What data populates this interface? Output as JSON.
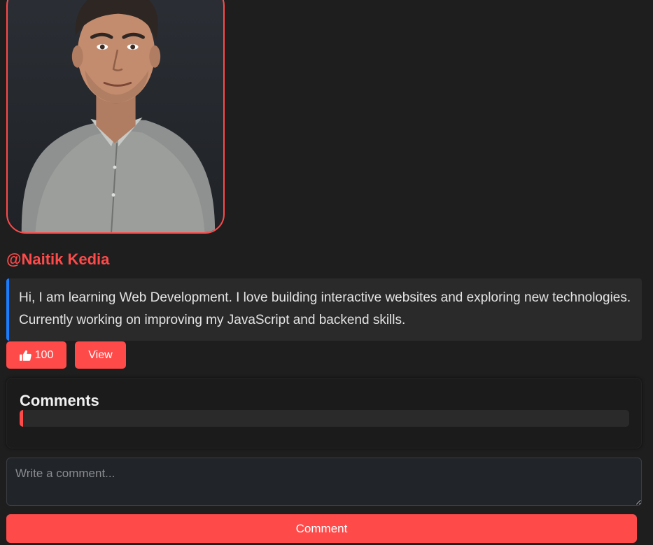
{
  "profile": {
    "username": "@Naitik Kedia",
    "bio": "Hi, I am learning Web Development. I love building interactive websites and exploring new technologies. Currently working on improving my JavaScript and backend skills.",
    "photo_icon": "profile-photo"
  },
  "actions": {
    "like_icon": "thumbs-up-icon",
    "like_count": "100",
    "view_label": "View"
  },
  "comments": {
    "title": "Comments",
    "items": []
  },
  "composer": {
    "placeholder": "Write a comment...",
    "value": "",
    "submit_label": "Comment"
  },
  "colors": {
    "accent": "#ff4a4a",
    "bio_border": "#1a7cff",
    "background": "#1e1e1e"
  }
}
